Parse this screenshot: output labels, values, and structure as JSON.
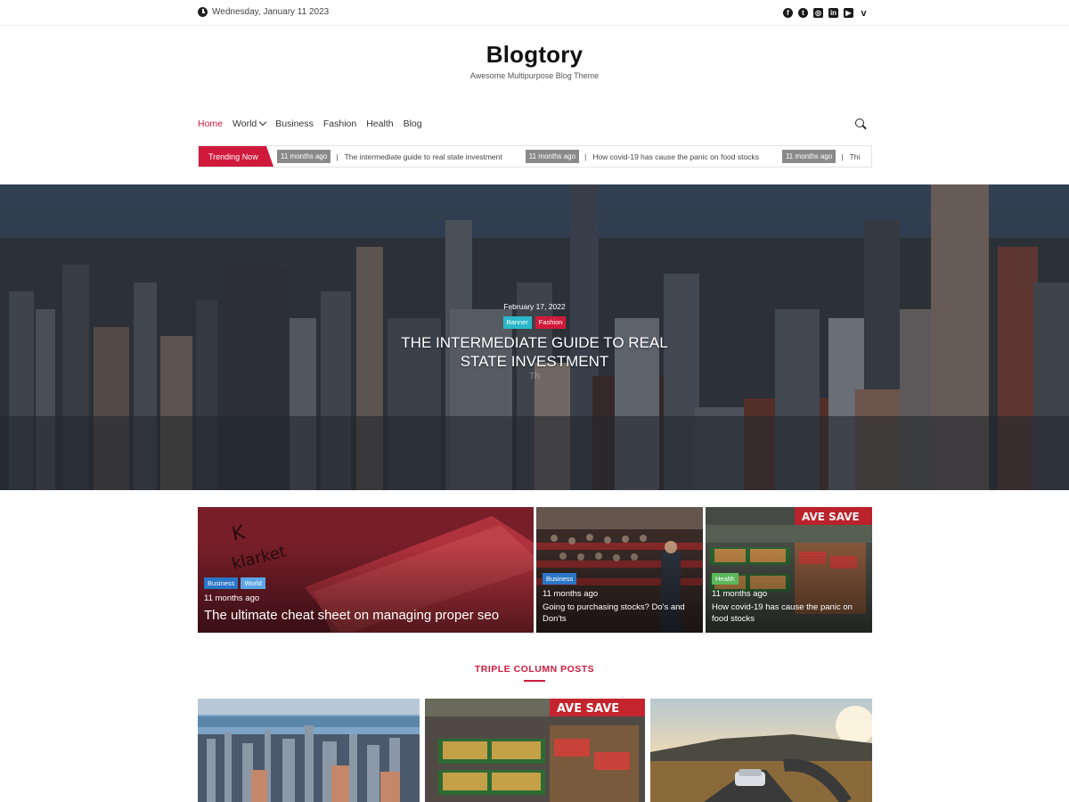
{
  "topbar": {
    "date": "Wednesday, January 11 2023",
    "social_icons": [
      "facebook-icon",
      "twitter-icon",
      "instagram-icon",
      "linkedin-icon",
      "youtube-icon",
      "vimeo-icon"
    ]
  },
  "site": {
    "title": "Blogtory",
    "tagline": "Awesome Multipurpose Blog Theme"
  },
  "nav": {
    "items": [
      "Home",
      "World",
      "Business",
      "Fashion",
      "Health",
      "Blog"
    ],
    "active": "Home",
    "search_icon": "search-icon"
  },
  "trending": {
    "label": "Trending Now",
    "items": [
      {
        "ago": "11 months ago",
        "title": "The intermediate guide to real state investment"
      },
      {
        "ago": "11 months ago",
        "title": "How covid-19 has cause the panic on food stocks"
      },
      {
        "ago": "11 months ago",
        "title": "Thi"
      }
    ]
  },
  "hero": {
    "date": "February 17, 2022",
    "categories": [
      "Banner",
      "Fashion"
    ],
    "title": "THE INTERMEDIATE GUIDE TO REAL STATE INVESTMENT",
    "excerpt": "Th"
  },
  "featured": [
    {
      "categories": [
        "Business",
        "World"
      ],
      "ago": "11 months ago",
      "title": "The ultimate cheat sheet on managing proper seo"
    },
    {
      "categories": [
        "Business"
      ],
      "ago": "11 months ago",
      "title": "Going to purchasing stocks? Do's and Don'ts"
    },
    {
      "categories": [
        "Health"
      ],
      "ago": "11 months ago",
      "title": "How covid-19 has cause the panic on food stocks"
    }
  ],
  "section": {
    "title": "TRIPLE COLUMN POSTS"
  },
  "colors": {
    "accent": "#d11a3b",
    "category_banner": "#2bb7c9",
    "category_business": "#2b76c6",
    "category_world": "#5aa5e6",
    "category_health": "#5cb75c"
  }
}
